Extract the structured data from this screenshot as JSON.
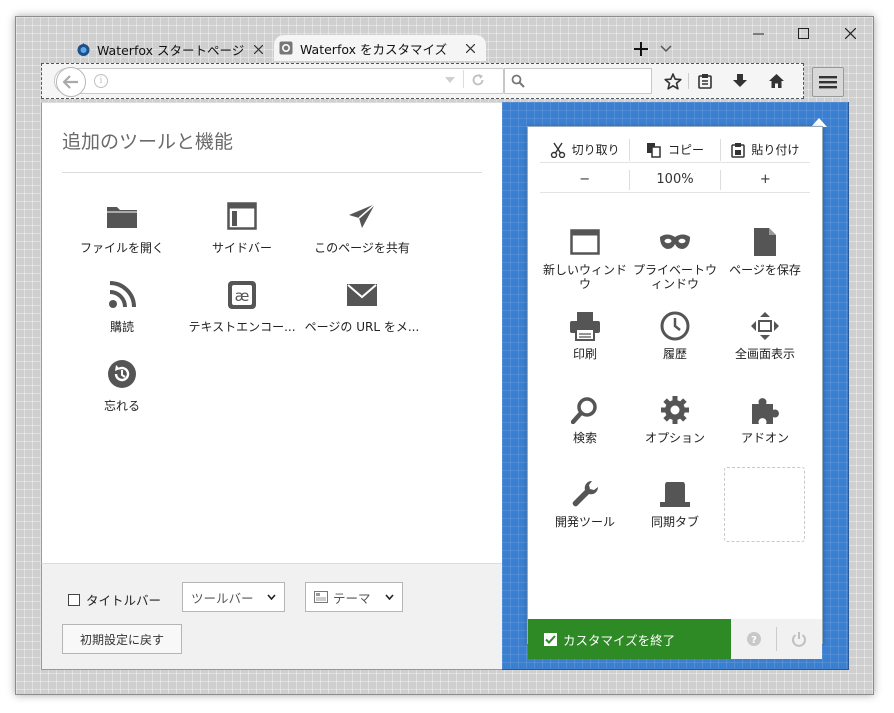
{
  "tabs": [
    {
      "title": "Waterfox スタートページ",
      "icon": "waterfox-icon"
    },
    {
      "title": "Waterfox をカスタマイズ",
      "icon": "gear-icon"
    }
  ],
  "palette": {
    "title": "追加のツールと機能",
    "items": [
      {
        "label": "ファイルを開く",
        "icon": "folder-icon"
      },
      {
        "label": "サイドバー",
        "icon": "sidebar-icon"
      },
      {
        "label": "このページを共有",
        "icon": "share-icon"
      },
      {
        "label": "購読",
        "icon": "rss-icon"
      },
      {
        "label": "テキストエンコー...",
        "icon": "encoding-icon"
      },
      {
        "label": "ページの URL をメ...",
        "icon": "email-icon"
      },
      {
        "label": "忘れる",
        "icon": "forget-icon"
      }
    ]
  },
  "footer": {
    "titlebar_label": "タイトルバー",
    "toolbars_label": "ツールバー",
    "themes_label": "テーマ",
    "reset_label": "初期設定に戻す"
  },
  "menu": {
    "cut": "切り取り",
    "copy": "コピー",
    "paste": "貼り付け",
    "zoom_out": "−",
    "zoom_level": "100%",
    "zoom_in": "+",
    "items": [
      {
        "label": "新しいウィンドウ",
        "icon": "new-window-icon"
      },
      {
        "label": "プライベートウィンドウ",
        "icon": "private-window-icon"
      },
      {
        "label": "ページを保存",
        "icon": "save-page-icon"
      },
      {
        "label": "印刷",
        "icon": "print-icon"
      },
      {
        "label": "履歴",
        "icon": "history-icon"
      },
      {
        "label": "全画面表示",
        "icon": "fullscreen-icon"
      },
      {
        "label": "検索",
        "icon": "search-icon"
      },
      {
        "label": "オプション",
        "icon": "options-icon"
      },
      {
        "label": "アドオン",
        "icon": "addons-icon"
      },
      {
        "label": "開発ツール",
        "icon": "developer-icon"
      },
      {
        "label": "同期タブ",
        "icon": "synced-tabs-icon"
      }
    ],
    "exit_label": "カスタマイズを終了"
  },
  "colors": {
    "accent_green": "#2e8a24",
    "customize_blue": "#3b7fd0"
  }
}
